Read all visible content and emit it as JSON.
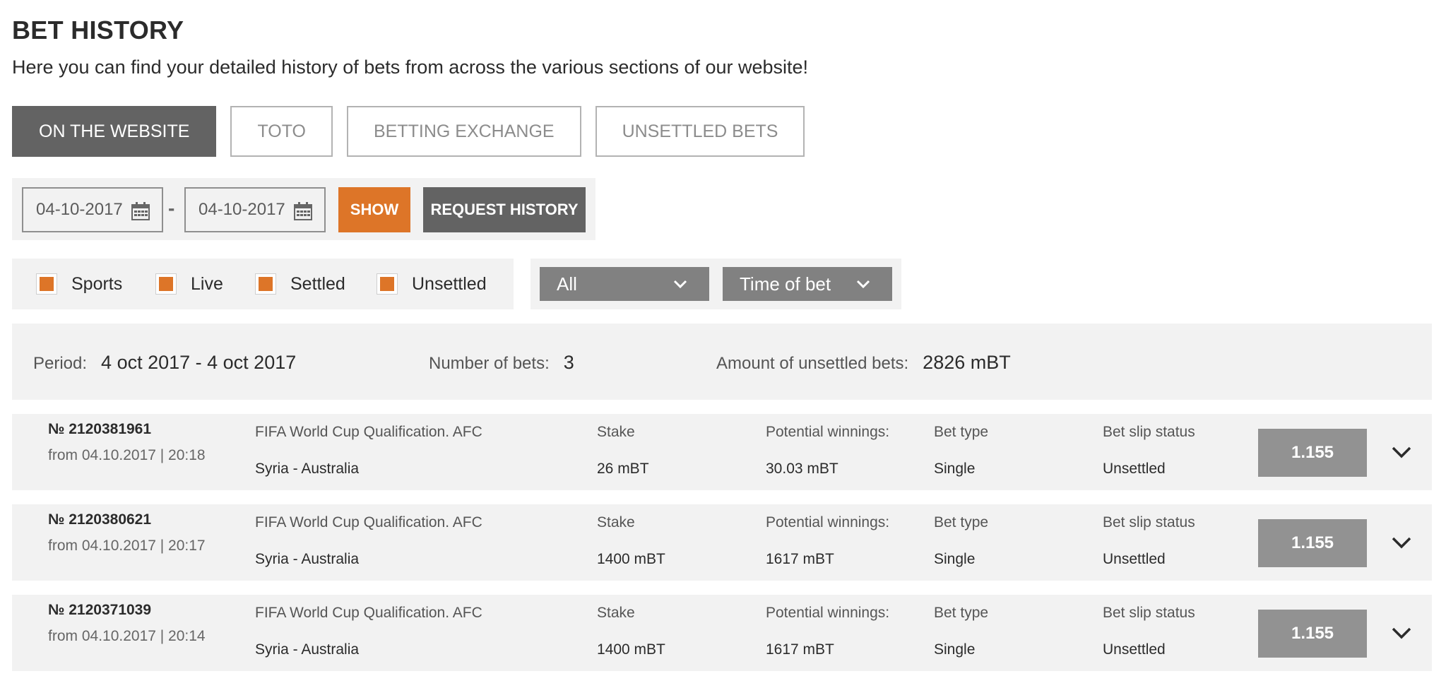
{
  "page": {
    "title": "BET HISTORY",
    "subtitle": "Here you can find your detailed history of bets from across the various sections of our website!"
  },
  "tabs": [
    {
      "label": "ON THE WEBSITE",
      "active": true
    },
    {
      "label": "TOTO",
      "active": false
    },
    {
      "label": "BETTING EXCHANGE",
      "active": false
    },
    {
      "label": "UNSETTLED BETS",
      "active": false
    }
  ],
  "date_range": {
    "from": "04-10-2017",
    "separator": "-",
    "to": "04-10-2017",
    "show_label": "SHOW",
    "request_label": "REQUEST HISTORY"
  },
  "filters": [
    {
      "label": "Sports",
      "checked": true
    },
    {
      "label": "Live",
      "checked": true
    },
    {
      "label": "Settled",
      "checked": true
    },
    {
      "label": "Unsettled",
      "checked": true
    }
  ],
  "selects": {
    "category": "All",
    "sort": "Time of bet"
  },
  "summary": {
    "period_label": "Period:",
    "period_value": "4 oct 2017 - 4 oct 2017",
    "count_label": "Number of bets:",
    "count_value": "3",
    "unsettled_label": "Amount of unsettled bets:",
    "unsettled_value": "2826 mBT"
  },
  "labels": {
    "stake": "Stake",
    "potential": "Potential winnings:",
    "bet_type": "Bet type",
    "status": "Bet slip status"
  },
  "bets": [
    {
      "number": "№ 2120381961",
      "from": "from 04.10.2017 | 20:18",
      "tournament": "FIFA World Cup Qualification. AFC",
      "match": "Syria - Australia",
      "stake": "26 mBT",
      "potential": "30.03 mBT",
      "bet_type": "Single",
      "status": "Unsettled",
      "odds": "1.155"
    },
    {
      "number": "№ 2120380621",
      "from": "from 04.10.2017 | 20:17",
      "tournament": "FIFA World Cup Qualification. AFC",
      "match": "Syria - Australia",
      "stake": "1400 mBT",
      "potential": "1617 mBT",
      "bet_type": "Single",
      "status": "Unsettled",
      "odds": "1.155"
    },
    {
      "number": "№ 2120371039",
      "from": "from 04.10.2017 | 20:14",
      "tournament": "FIFA World Cup Qualification. AFC",
      "match": "Syria - Australia",
      "stake": "1400 mBT",
      "potential": "1617 mBT",
      "bet_type": "Single",
      "status": "Unsettled",
      "odds": "1.155"
    }
  ],
  "colors": {
    "accent": "#dd7528",
    "dark_button": "#636363",
    "select_bg": "#818181",
    "odds_bg": "#929292",
    "panel_bg": "#f2f2f2"
  },
  "icons": {
    "date_picker": "calendar-icon",
    "dropdown": "chevron-down-icon",
    "expand": "chevron-down-icon"
  }
}
